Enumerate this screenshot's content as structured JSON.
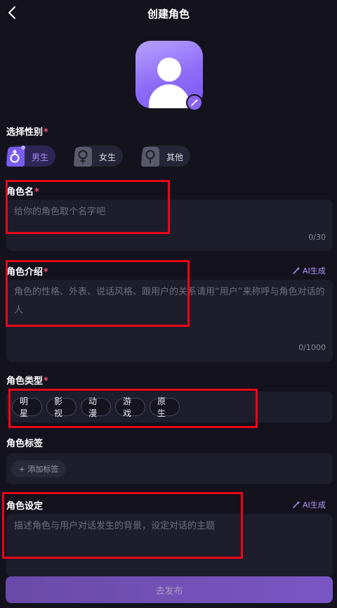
{
  "header": {
    "title": "创建角色"
  },
  "avatar": {
    "edit_icon": "magic-wand-icon"
  },
  "gender": {
    "label": "选择性别",
    "required_mark": "*",
    "options": [
      {
        "label": "男生",
        "icon": "male-icon",
        "selected": true
      },
      {
        "label": "女生",
        "icon": "female-icon",
        "selected": false
      },
      {
        "label": "其他",
        "icon": "other-gender-icon",
        "selected": false
      }
    ]
  },
  "name": {
    "label": "角色名",
    "required_mark": "*",
    "placeholder": "给你的角色取个名字吧",
    "counter": "0/30"
  },
  "intro": {
    "label": "角色介绍",
    "required_mark": "*",
    "ai_label": "AI生成",
    "placeholder": "角色的性格、外表、说话风格、跟用户的关系请用“用户”来称呼与角色对话的人",
    "counter": "0/1000"
  },
  "type": {
    "label": "角色类型",
    "required_mark": "*",
    "chips": [
      "明星",
      "影视",
      "动漫",
      "游戏",
      "原生"
    ]
  },
  "tags": {
    "label": "角色标签",
    "add_label": "+ 添加标签"
  },
  "setting": {
    "label": "角色设定",
    "ai_label": "AI生成",
    "placeholder": "描述角色与用户对话发生的背景，设定对话的主题"
  },
  "publish": {
    "label": "去发布"
  },
  "colors": {
    "background": "#13121d",
    "card": "#1e1d2b",
    "accent": "#a88bff",
    "required": "#ff4d67",
    "highlight": "#e8071a"
  }
}
